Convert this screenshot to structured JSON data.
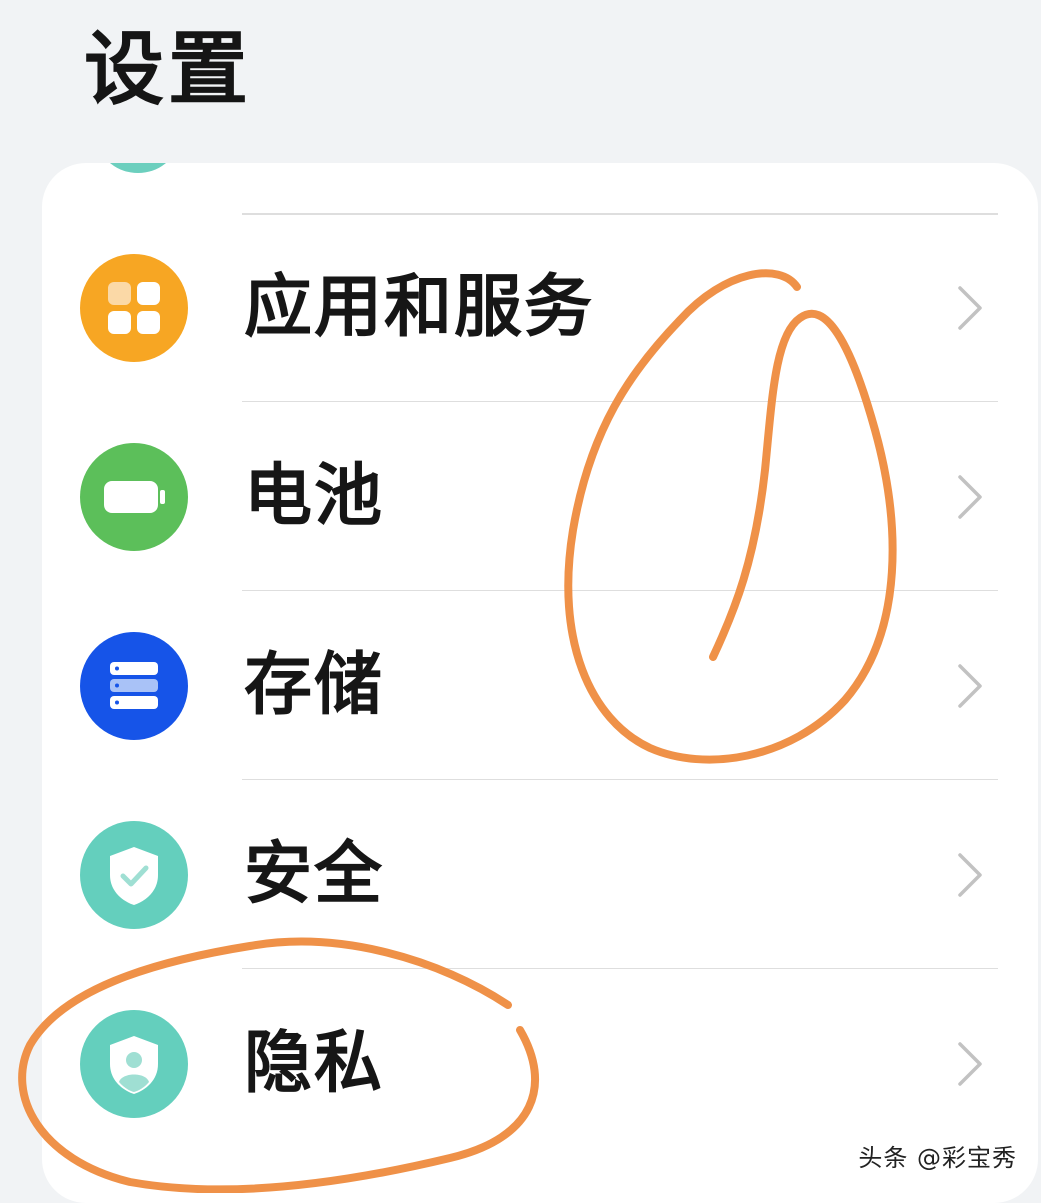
{
  "page": {
    "title": "设置"
  },
  "settings": {
    "items": [
      {
        "label": "应用和服务",
        "icon": "apps-grid-icon",
        "color": "#f7a623"
      },
      {
        "label": "电池",
        "icon": "battery-icon",
        "color": "#5cbf5a"
      },
      {
        "label": "存储",
        "icon": "storage-icon",
        "color": "#1654e8"
      },
      {
        "label": "安全",
        "icon": "shield-check-icon",
        "color": "#64cfbd"
      },
      {
        "label": "隐私",
        "icon": "shield-person-icon",
        "color": "#64cfbd"
      }
    ]
  },
  "annotation": {
    "color": "#ef9148"
  },
  "watermark": {
    "text": "头条 @彩宝秀"
  }
}
